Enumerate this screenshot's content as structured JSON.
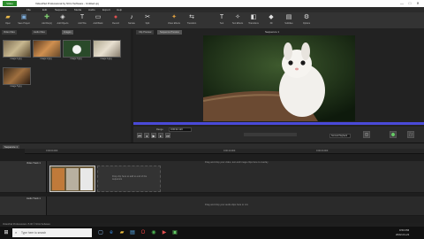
{
  "app": {
    "title": "VideoPad Professional by NCH Software - Untitled.vpj",
    "app_button": "Video",
    "window_controls": [
      "—",
      "□",
      "✕"
    ]
  },
  "menu": [
    "File",
    "Edit",
    "Sequence",
    "Media",
    "Audio",
    "Export",
    "Help"
  ],
  "ribbon": [
    {
      "label": "Open",
      "icon": "folder-icon"
    },
    {
      "label": "Save Project",
      "icon": "save-icon"
    },
    {
      "label": "Add File(s)",
      "icon": "add-file-icon"
    },
    {
      "label": "Add Objects",
      "icon": "add-objects-icon"
    },
    {
      "label": "Add Title",
      "icon": "title-icon"
    },
    {
      "label": "Add Blank",
      "icon": "blank-icon"
    },
    {
      "label": "Record",
      "icon": "record-icon"
    },
    {
      "label": "Narrate",
      "icon": "mic-icon"
    },
    {
      "label": "Split",
      "icon": "split-icon"
    },
    {
      "label": "Video Effects",
      "icon": "fx-icon"
    },
    {
      "label": "Transition",
      "icon": "transition-icon"
    },
    {
      "label": "Text",
      "icon": "text-icon"
    },
    {
      "label": "Text Effects",
      "icon": "text-effects-icon"
    },
    {
      "label": "Transitions",
      "icon": "transitions-icon"
    },
    {
      "label": "3D",
      "icon": "3d-icon"
    },
    {
      "label": "Subtitles",
      "icon": "subtitles-icon"
    },
    {
      "label": "Options",
      "icon": "gear-icon"
    }
  ],
  "bin": {
    "tabs": [
      "Video Files",
      "Audio Files",
      "Images"
    ],
    "items": [
      {
        "caption": "image 1.jpg"
      },
      {
        "caption": "image 2.jpg"
      },
      {
        "caption": "image 3.jpg"
      },
      {
        "caption": "image 4.jpg"
      },
      {
        "caption": "image 5.jpg"
      }
    ]
  },
  "preview": {
    "tabs": [
      "Clip Preview",
      "Sequence Preview"
    ],
    "title": "Sequence 1",
    "time_label": "Range",
    "timecode": "0:00:02.123",
    "playback": "Normal Playback"
  },
  "timeline": {
    "sequence_tab": "Sequence 1",
    "ruler": [
      "0:00:00.000",
      "0:00:10.000",
      "0:00:20.000"
    ],
    "video_track": "Video Track 1",
    "audio_track": "Audio Track 1",
    "video_hint": "Drag and drop your video, text and image clips here to overlay",
    "clip_hint": "Drop clip here to add to end of the sequence",
    "audio_hint": "Drag and drop your audio clips here to mix"
  },
  "status_text": "VideoPad Professional v 5.00 © NCH Software",
  "taskbar": {
    "search_placeholder": "Type here to search",
    "clock_time": "9:53 PM",
    "clock_date": "2022-01-21"
  }
}
